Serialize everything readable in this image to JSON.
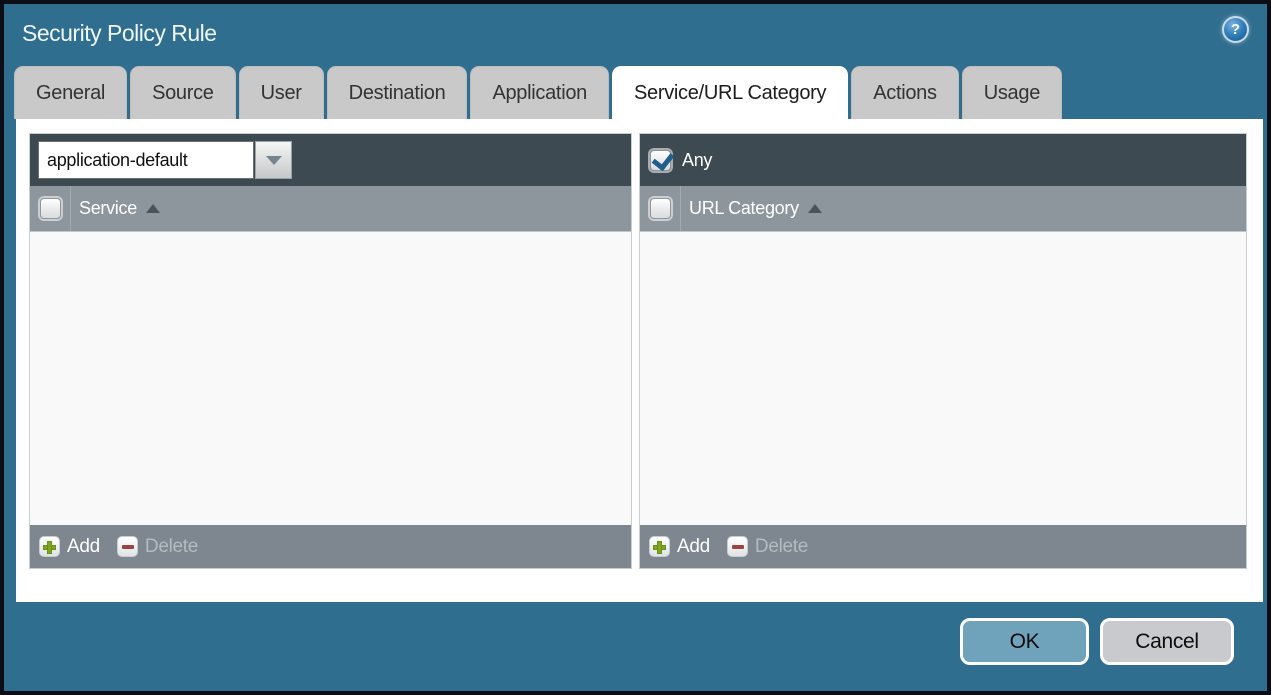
{
  "window": {
    "title": "Security Policy Rule"
  },
  "icons": {
    "help": "?"
  },
  "tabs": [
    {
      "label": "General"
    },
    {
      "label": "Source"
    },
    {
      "label": "User"
    },
    {
      "label": "Destination"
    },
    {
      "label": "Application"
    },
    {
      "label": "Service/URL Category"
    },
    {
      "label": "Actions"
    },
    {
      "label": "Usage"
    }
  ],
  "active_tab": "Service/URL Category",
  "service_panel": {
    "dropdown_value": "application-default",
    "column_header": "Service",
    "rows": [],
    "add_label": "Add",
    "delete_label": "Delete",
    "delete_enabled": false
  },
  "url_category_panel": {
    "any_label": "Any",
    "any_checked": true,
    "column_header": "URL Category",
    "rows": [],
    "add_label": "Add",
    "delete_label": "Delete",
    "delete_enabled": false
  },
  "dialog_buttons": {
    "ok": "OK",
    "cancel": "Cancel"
  },
  "colors": {
    "titlebar_teal": "#2f6e8e",
    "panel_header_dark": "#3e4a52",
    "column_header_gray": "#8d969d",
    "footer_bar_gray": "#7e878f",
    "ok_button_blue": "#6fa2bb",
    "cancel_button_gray": "#c9cacd",
    "check_blue": "#205e8c",
    "add_icon_green": "#7fa521",
    "delete_icon_red": "#9c4343"
  }
}
